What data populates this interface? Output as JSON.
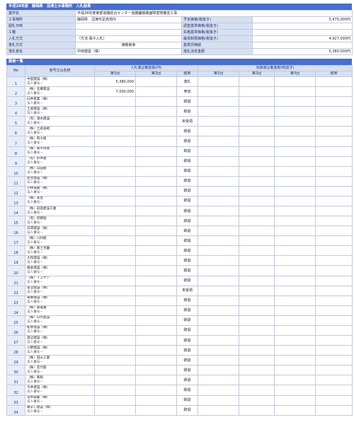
{
  "title": "平成28年度　静岡県　沼津土木事務所　入札結果",
  "info": {
    "rows": [
      {
        "label": "案件名",
        "value": "平成28年度東部道路総合センター道路舗装路面障害物撤去工事",
        "label2": "",
        "value2": ""
      },
      {
        "label": "工事場所",
        "value": "静岡県　沼津市足高地内",
        "label2": "予定価格(税抜き)",
        "value2": "5,475,000円"
      },
      {
        "label": "開札日時",
        "value": "",
        "label2": "調査基準価格(税抜き)",
        "value2": ""
      },
      {
        "label": "工種",
        "value": "",
        "label2": "失格基準価格(税抜き)",
        "value2": ""
      },
      {
        "label": "入札方式",
        "value": "（方法:電子入札）",
        "label2": "最低制限価格(税抜き)",
        "value2": "4,927,000円"
      },
      {
        "label": "落札方式",
        "value": "価格競争",
        "label2": "基準評価値",
        "value2": ""
      },
      {
        "label": "落札者名",
        "value": "中田建設（株）",
        "label2": "落札決定金額",
        "value2": "5,380,000円"
      }
    ]
  },
  "list_title": "業者一覧",
  "columns": {
    "no": "No",
    "name": "商号又は名称",
    "price_group": "入札書記載金額(円)",
    "estimate_group": "見積書記載金額(税抜き)",
    "round1": "第1回",
    "round2": "第2回",
    "round3": "第3回",
    "result": "結果"
  },
  "rep_label": "法人番号－",
  "bidders": [
    {
      "no": "1",
      "name": "中田建設（株）",
      "r1": "5,380,000",
      "r2": "",
      "result": "落札"
    },
    {
      "no": "2",
      "name": "（株）北郷建設",
      "r1": "7,000,000",
      "r2": "",
      "result": "参加"
    },
    {
      "no": "3",
      "name": "臼井産業（株）",
      "r1": "",
      "r2": "",
      "result": "辞退"
    },
    {
      "no": "4",
      "name": "土屋建設（株）",
      "r1": "",
      "r2": "",
      "result": "辞退"
    },
    {
      "no": "5",
      "name": "（有）澤木建設",
      "r1": "",
      "r2": "",
      "result": "未受領"
    },
    {
      "no": "6",
      "name": "（株）土岐谷組",
      "r1": "",
      "r2": "",
      "result": "辞退"
    },
    {
      "no": "7",
      "name": "（株）和大組",
      "r1": "",
      "r2": "",
      "result": "辞退"
    },
    {
      "no": "8",
      "name": "（株）東平商会",
      "r1": "",
      "r2": "",
      "result": "辞退"
    },
    {
      "no": "9",
      "name": "（有）鈴木組",
      "r1": "",
      "r2": "",
      "result": "辞退"
    },
    {
      "no": "10",
      "name": "（株）山田組",
      "r1": "",
      "r2": "",
      "result": "辞退"
    },
    {
      "no": "11",
      "name": "臣合建設（株）",
      "r1": "",
      "r2": "",
      "result": "辞退"
    },
    {
      "no": "12",
      "name": "小林道路（株）",
      "r1": "",
      "r2": "",
      "result": "辞退"
    },
    {
      "no": "13",
      "name": "（株）高島",
      "r1": "",
      "r2": "",
      "result": "辞退"
    },
    {
      "no": "14",
      "name": "（株）前田建設工業",
      "r1": "",
      "r2": "",
      "result": "辞退"
    },
    {
      "no": "15",
      "name": "（有）岸野組",
      "r1": "",
      "r2": "",
      "result": "辞退"
    },
    {
      "no": "16",
      "name": "日環建設（株）",
      "r1": "",
      "r2": "",
      "result": "辞退"
    },
    {
      "no": "17",
      "name": "（株）川村組",
      "r1": "",
      "r2": "",
      "result": "辞退"
    },
    {
      "no": "18",
      "name": "（株）富士見園",
      "r1": "",
      "r2": "",
      "result": "辞退"
    },
    {
      "no": "19",
      "name": "大和建設（株）",
      "r1": "",
      "r2": "",
      "result": "辞退"
    },
    {
      "no": "20",
      "name": "勝倉建設（株）",
      "r1": "",
      "r2": "",
      "result": "辞退"
    },
    {
      "no": "21",
      "name": "（株）イズケン",
      "r1": "",
      "r2": "",
      "result": "辞退"
    },
    {
      "no": "22",
      "name": "菅沼建設（株）",
      "r1": "",
      "r2": "",
      "result": "未受領"
    },
    {
      "no": "23",
      "name": "東静建設（株）",
      "r1": "",
      "r2": "",
      "result": "辞退"
    },
    {
      "no": "24",
      "name": "（株）関電業",
      "r1": "",
      "r2": "",
      "result": "辞退"
    },
    {
      "no": "25",
      "name": "（株）日代建設",
      "r1": "",
      "r2": "",
      "result": "辞退"
    },
    {
      "no": "26",
      "name": "松井建設（株）",
      "r1": "",
      "r2": "",
      "result": "辞退"
    },
    {
      "no": "27",
      "name": "渡辺建設（株）",
      "r1": "",
      "r2": "",
      "result": "辞退"
    },
    {
      "no": "28",
      "name": "小野建設（株）",
      "r1": "",
      "r2": "",
      "result": "辞退"
    },
    {
      "no": "29",
      "name": "（株）田山工業",
      "r1": "",
      "r2": "",
      "result": "辞退"
    },
    {
      "no": "30",
      "name": "（株）宮代組",
      "r1": "",
      "r2": "",
      "result": "辞退"
    },
    {
      "no": "31",
      "name": "（株）峯組",
      "r1": "",
      "r2": "",
      "result": "辞退"
    },
    {
      "no": "32",
      "name": "今井建設（株）",
      "r1": "",
      "r2": "",
      "result": "辞退"
    },
    {
      "no": "33",
      "name": "常木興業（株）",
      "r1": "",
      "r2": "",
      "result": "辞退"
    },
    {
      "no": "34",
      "name": "鵜よし建設（株）",
      "r1": "",
      "r2": "",
      "result": "辞退"
    }
  ]
}
